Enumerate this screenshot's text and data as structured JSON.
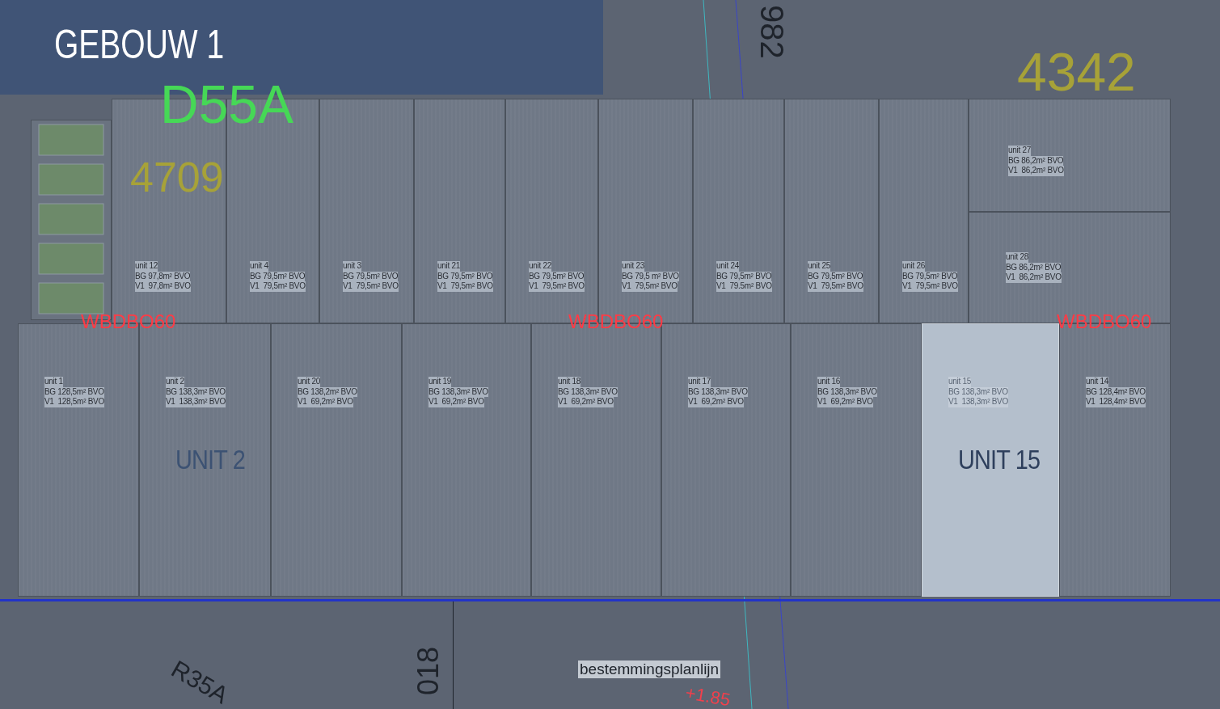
{
  "header": {
    "title": "GEBOUW 1"
  },
  "upper_units": [
    {
      "name": "unit 12",
      "bg": "BG 97,8m² BVO",
      "v1": "V1  97,8m² BVO",
      "selected": false
    },
    {
      "name": "unit 4",
      "bg": "BG 79,5m² BVO",
      "v1": "V1  79,5m² BVO",
      "selected": false
    },
    {
      "name": "unit 3",
      "bg": "BG 79,5m² BVO",
      "v1": "V1  79,5m² BVO",
      "selected": false
    },
    {
      "name": "unit 21",
      "bg": "BG 79,5m² BVO",
      "v1": "V1  79,5m² BVO",
      "selected": false
    },
    {
      "name": "unit 22",
      "bg": "BG 79,5m² BVO",
      "v1": "V1  79,5m² BVO",
      "selected": false
    },
    {
      "name": "unit 23",
      "bg": "BG 79,5 m² BVO",
      "v1": "V1  79,5m² BVO",
      "selected": false
    },
    {
      "name": "unit 24",
      "bg": "BG 79,5m² BVO",
      "v1": "V1  79.5m² BVO",
      "selected": false
    },
    {
      "name": "unit 25",
      "bg": "BG 79,5m² BVO",
      "v1": "V1  79,5m² BVO",
      "selected": false
    },
    {
      "name": "unit 26",
      "bg": "BG 79,5m² BVO",
      "v1": "V1  79,5m² BVO",
      "selected": false
    },
    {
      "name": "unit 27",
      "bg": "BG 86,2m² BVO",
      "v1": "V1  86,2m² BVO",
      "selected": false
    },
    {
      "name": "unit 28",
      "bg": "BG 86,2m² BVO",
      "v1": "V1  86,2m² BVO",
      "selected": false
    }
  ],
  "lower_units": [
    {
      "name": "unit 1",
      "bg": "BG 128,5m² BVO",
      "v1": "V1  128,5m² BVO",
      "selected": false
    },
    {
      "name": "unit 2",
      "bg": "BG 138,3m² BVO",
      "v1": "V1  138,3m² BVO",
      "selected": false,
      "overlay_label": "UNIT 2"
    },
    {
      "name": "unit 20",
      "bg": "BG 138,2m² BVO",
      "v1": "V1  69,2m² BVO",
      "selected": false
    },
    {
      "name": "unit 19",
      "bg": "BG 138,3m² BVO",
      "v1": "V1  69,2m² BVO",
      "selected": false
    },
    {
      "name": "unit 18",
      "bg": "BG 138,3m² BVO",
      "v1": "V1  69,2m² BVO",
      "selected": false
    },
    {
      "name": "unit 17",
      "bg": "BG 138,3m² BVO",
      "v1": "V1  69,2m² BVO",
      "selected": false
    },
    {
      "name": "unit 16",
      "bg": "BG 138,3m² BVO",
      "v1": "V1  69,2m² BVO",
      "selected": false
    },
    {
      "name": "unit 15",
      "bg": "BG 138,3m² BVO",
      "v1": "V1  138,3m² BVO",
      "selected": true,
      "overlay_label": "UNIT 15"
    },
    {
      "name": "unit 14",
      "bg": "BG 128,4m² BVO",
      "v1": "V1  128,4m² BVO",
      "selected": false
    }
  ],
  "fire_walls": [
    "WBDBO60",
    "WBDBO60",
    "WBDBO60"
  ],
  "plan_marks": [
    {
      "text": "D55A",
      "color": "#46d856"
    },
    {
      "text": "4709",
      "color": "#a7a238"
    },
    {
      "text": "4342",
      "color": "#a7a238"
    },
    {
      "text": "982",
      "color": "#1e232b"
    },
    {
      "text": "R35A",
      "color": "#1e232b"
    },
    {
      "text": "018",
      "color": "#1e232b"
    },
    {
      "text": "+1.85",
      "color": "#f0404c"
    }
  ],
  "boundary_label": "bestemmingsplanlijn"
}
